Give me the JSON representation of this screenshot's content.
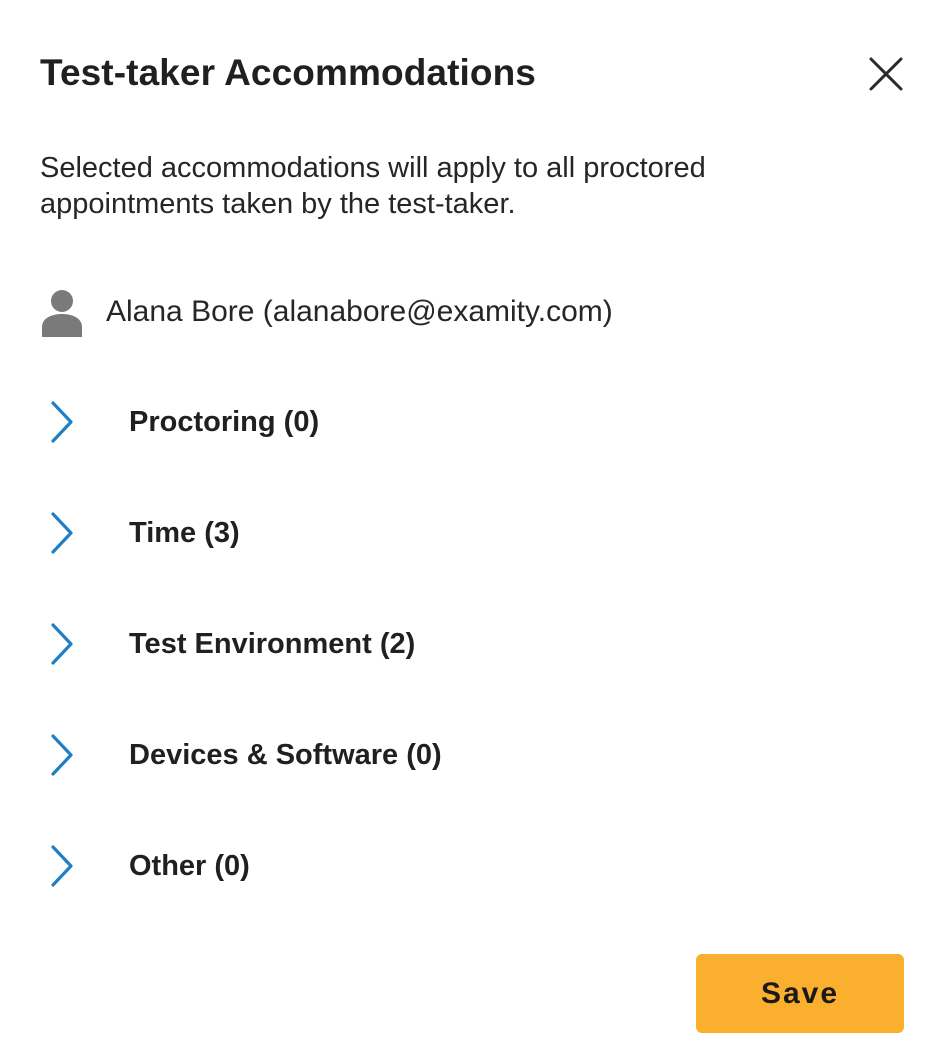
{
  "dialog": {
    "title": "Test-taker Accommodations",
    "close_icon": "close-icon",
    "description": "Selected accommodations will apply to all proctored appointments taken by the test-taker.",
    "user": {
      "icon": "person-icon",
      "display": "Alana Bore (alanabore@examity.com)"
    },
    "sections": [
      {
        "label": "Proctoring (0)",
        "icon": "chevron-right-icon"
      },
      {
        "label": "Time (3)",
        "icon": "chevron-right-icon"
      },
      {
        "label": "Test Environment (2)",
        "icon": "chevron-right-icon"
      },
      {
        "label": "Devices & Software (0)",
        "icon": "chevron-right-icon"
      },
      {
        "label": "Other (0)",
        "icon": "chevron-right-icon"
      }
    ],
    "save_label": "Save"
  },
  "colors": {
    "accent_chevron": "#1F7FC4",
    "save_button": "#FBAF2E",
    "user_icon": "#7A7A7A",
    "text": "#202020"
  }
}
